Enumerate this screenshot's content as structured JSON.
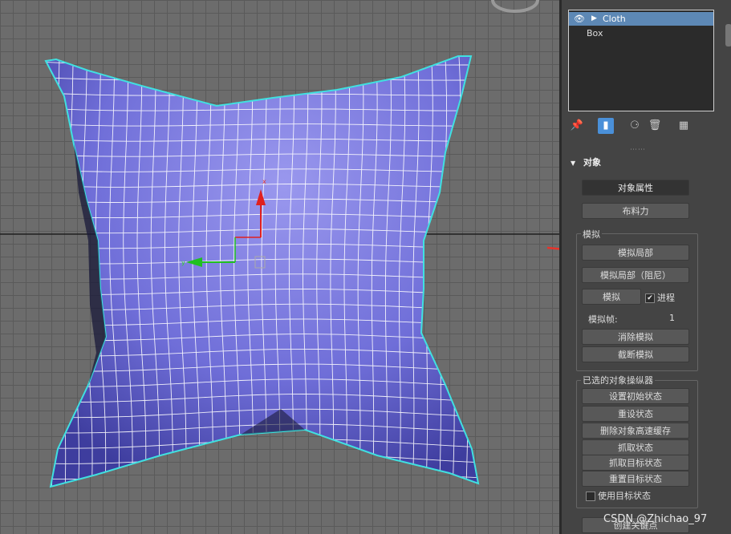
{
  "scene": {
    "objects": [
      {
        "label": "Cloth",
        "selected": true
      },
      {
        "label": "Box",
        "selected": false
      }
    ]
  },
  "toolbar": {
    "icons": [
      "pin-icon",
      "modifier-icon",
      "clone-icon",
      "delete-icon",
      "config-icon"
    ]
  },
  "rollout": {
    "title": "对象",
    "object_props_label": "对象属性",
    "cloth_forces_label": "布料力",
    "simulation": {
      "group_label": "模拟",
      "local_label": "模拟局部",
      "local_damped_label": "模拟局部（阻尼）",
      "simulate_label": "模拟",
      "progress_label": "进程",
      "progress_checked": true,
      "frame_label": "模拟帧:",
      "frame_value": "1",
      "erase_label": "消除模拟",
      "truncate_label": "截断模拟"
    },
    "selected_manipulators": {
      "group_label": "已选的对象操纵器",
      "set_initial_label": "设置初始状态",
      "reset_label": "重设状态",
      "delete_cache_label": "删除对象高速缓存",
      "grab_label": "抓取状态",
      "grab_target_label": "抓取目标状态",
      "reset_target_label": "重置目标状态",
      "use_target_label": "使用目标状态",
      "use_target_checked": false
    },
    "bottom_button_label": "创建关键点"
  },
  "viewport": {
    "axis_labels": {
      "x": "x",
      "y": "y"
    },
    "colors": {
      "cloth": "#6f6ed8",
      "wire": "#ffffff",
      "outline": "#40e0e0",
      "grid": "#5a5a5a"
    }
  },
  "watermark": "CSDN @Zhichao_97",
  "colors": {
    "selection": "#5d88b5",
    "accent": "#4a90d9",
    "arrow": "#e8332a"
  }
}
